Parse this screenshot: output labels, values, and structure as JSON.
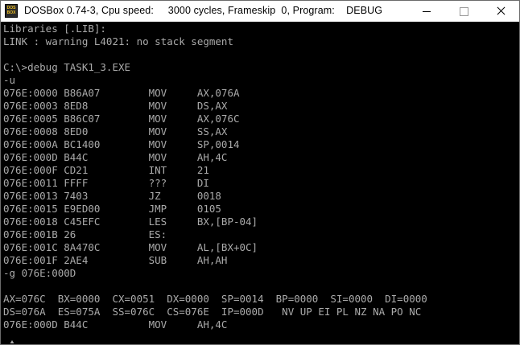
{
  "window": {
    "title": "DOSBox 0.74-3, Cpu speed:     3000 cycles, Frameskip  0, Program:    DEBUG",
    "icon_label": "DOS\nBOX"
  },
  "terminal": {
    "lines": [
      "Libraries [.LIB]:",
      "LINK : warning L4021: no stack segment",
      "",
      "C:\\>debug TASK1_3.EXE",
      "-u",
      "076E:0000 B86A07        MOV     AX,076A",
      "076E:0003 8ED8          MOV     DS,AX",
      "076E:0005 B86C07        MOV     AX,076C",
      "076E:0008 8ED0          MOV     SS,AX",
      "076E:000A BC1400        MOV     SP,0014",
      "076E:000D B44C          MOV     AH,4C",
      "076E:000F CD21          INT     21",
      "076E:0011 FFFF          ???     DI",
      "076E:0013 7403          JZ      0018",
      "076E:0015 E9ED00        JMP     0105",
      "076E:0018 C45EFC        LES     BX,[BP-04]",
      "076E:001B 26            ES:",
      "076E:001C 8A470C        MOV     AL,[BX+0C]",
      "076E:001F 2AE4          SUB     AH,AH",
      "-g 076E:000D",
      "",
      "AX=076C  BX=0000  CX=0051  DX=0000  SP=0014  BP=0000  SI=0000  DI=0000",
      "DS=076A  ES=075A  SS=076C  CS=076E  IP=000D   NV UP EI PL NZ NA PO NC",
      "076E:000D B44C          MOV     AH,4C"
    ],
    "prompt": "-"
  },
  "colors": {
    "terminal_bg": "#000000",
    "terminal_fg": "#aaaaaa",
    "titlebar_bg": "#ffffff"
  }
}
